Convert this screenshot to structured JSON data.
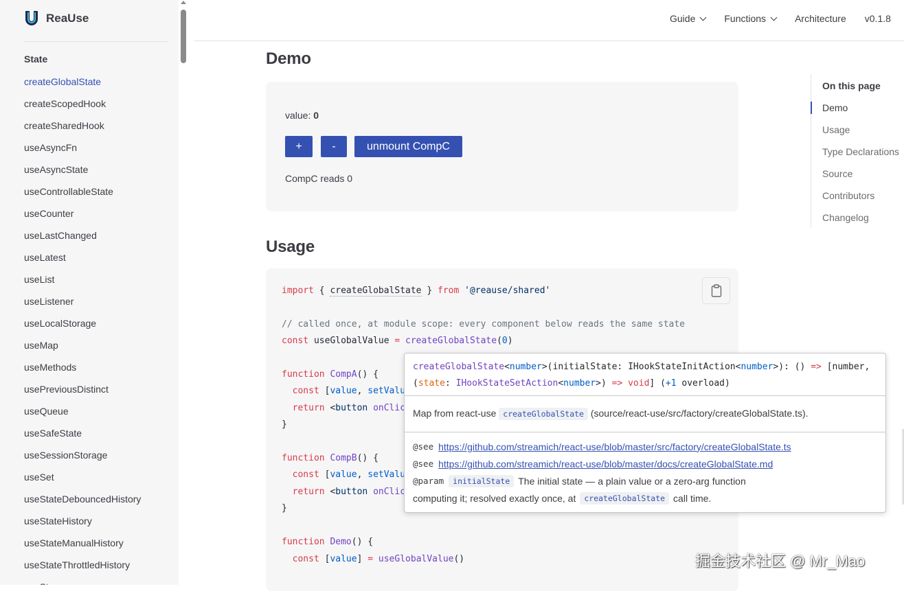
{
  "app": {
    "name": "ReaUse",
    "logo_letter": "U"
  },
  "sidebar": {
    "section": "State",
    "items": [
      "createGlobalState",
      "createScopedHook",
      "createSharedHook",
      "useAsyncFn",
      "useAsyncState",
      "useControllableState",
      "useCounter",
      "useLastChanged",
      "useLatest",
      "useList",
      "useListener",
      "useLocalStorage",
      "useMap",
      "useMethods",
      "usePreviousDistinct",
      "useQueue",
      "useSafeState",
      "useSessionStorage",
      "useSet",
      "useStateDebouncedHistory",
      "useStateHistory",
      "useStateManualHistory",
      "useStateThrottledHistory",
      "useSt"
    ],
    "active": "createGlobalState"
  },
  "topnav": {
    "guide": "Guide",
    "functions": "Functions",
    "architecture": "Architecture",
    "version": "v0.1.8"
  },
  "demo": {
    "heading": "Demo",
    "value_label": "value:",
    "value": "0",
    "plus_label": "+",
    "minus_label": "-",
    "unmount_label": "unmount CompC",
    "compc_text": "CompC reads 0"
  },
  "usage": {
    "heading": "Usage"
  },
  "code": {
    "lines": [
      "import { createGlobalState } from '@reause/shared'",
      "",
      "// called once, at module scope: every component below reads the same state",
      "const useGlobalValue = createGlobalState(0)",
      "",
      "function CompA() {",
      "  const [value, setValu",
      "  return <button onClic",
      "}",
      "",
      "function CompB() {",
      "  const [value, setValu",
      "  return <button onClic",
      "}",
      "",
      "function Demo() {",
      "  const [value] = useGlobalValue()"
    ]
  },
  "toc": {
    "title": "On this page",
    "items": [
      "Demo",
      "Usage",
      "Type Declarations",
      "Source",
      "Contributors",
      "Changelog"
    ],
    "active": "Demo"
  },
  "tooltip": {
    "sig_line1_parts": [
      "createGlobalState",
      "<",
      "number",
      ">(initialState: IHookStateInitAction",
      "<",
      "number",
      ">): () ",
      "=>",
      " [number,"
    ],
    "sig_line2_parts": [
      "(",
      "state",
      ": ",
      "IHookStateSetAction",
      "<",
      "number",
      ">) ",
      "=>",
      " ",
      "void",
      "] (",
      "+1",
      " overload)"
    ],
    "desc_prefix": "Map from react-use",
    "desc_code": "createGlobalState",
    "desc_suffix": "(source/react-use/src/factory/createGlobalState.ts).",
    "see_tag": "@see",
    "see_link_1": "https://github.com/streamich/react-use/blob/master/src/factory/createGlobalState.ts",
    "see_link_2": "https://github.com/streamich/react-use/blob/master/docs/createGlobalState.md",
    "param_tag": "@param",
    "param_name": "initialState",
    "param_text_1": "The initial state — a plain value or a zero-arg function",
    "param_text_2a": "computing it; resolved exactly once, at",
    "param_code": "createGlobalState",
    "param_text_2b": "call time."
  },
  "watermark": "掘金技术社区 @ Mr_Mao",
  "colors": {
    "brand": "#3451b2",
    "sidebar_bg": "#f6f6f7",
    "text": "#3c3c43"
  }
}
